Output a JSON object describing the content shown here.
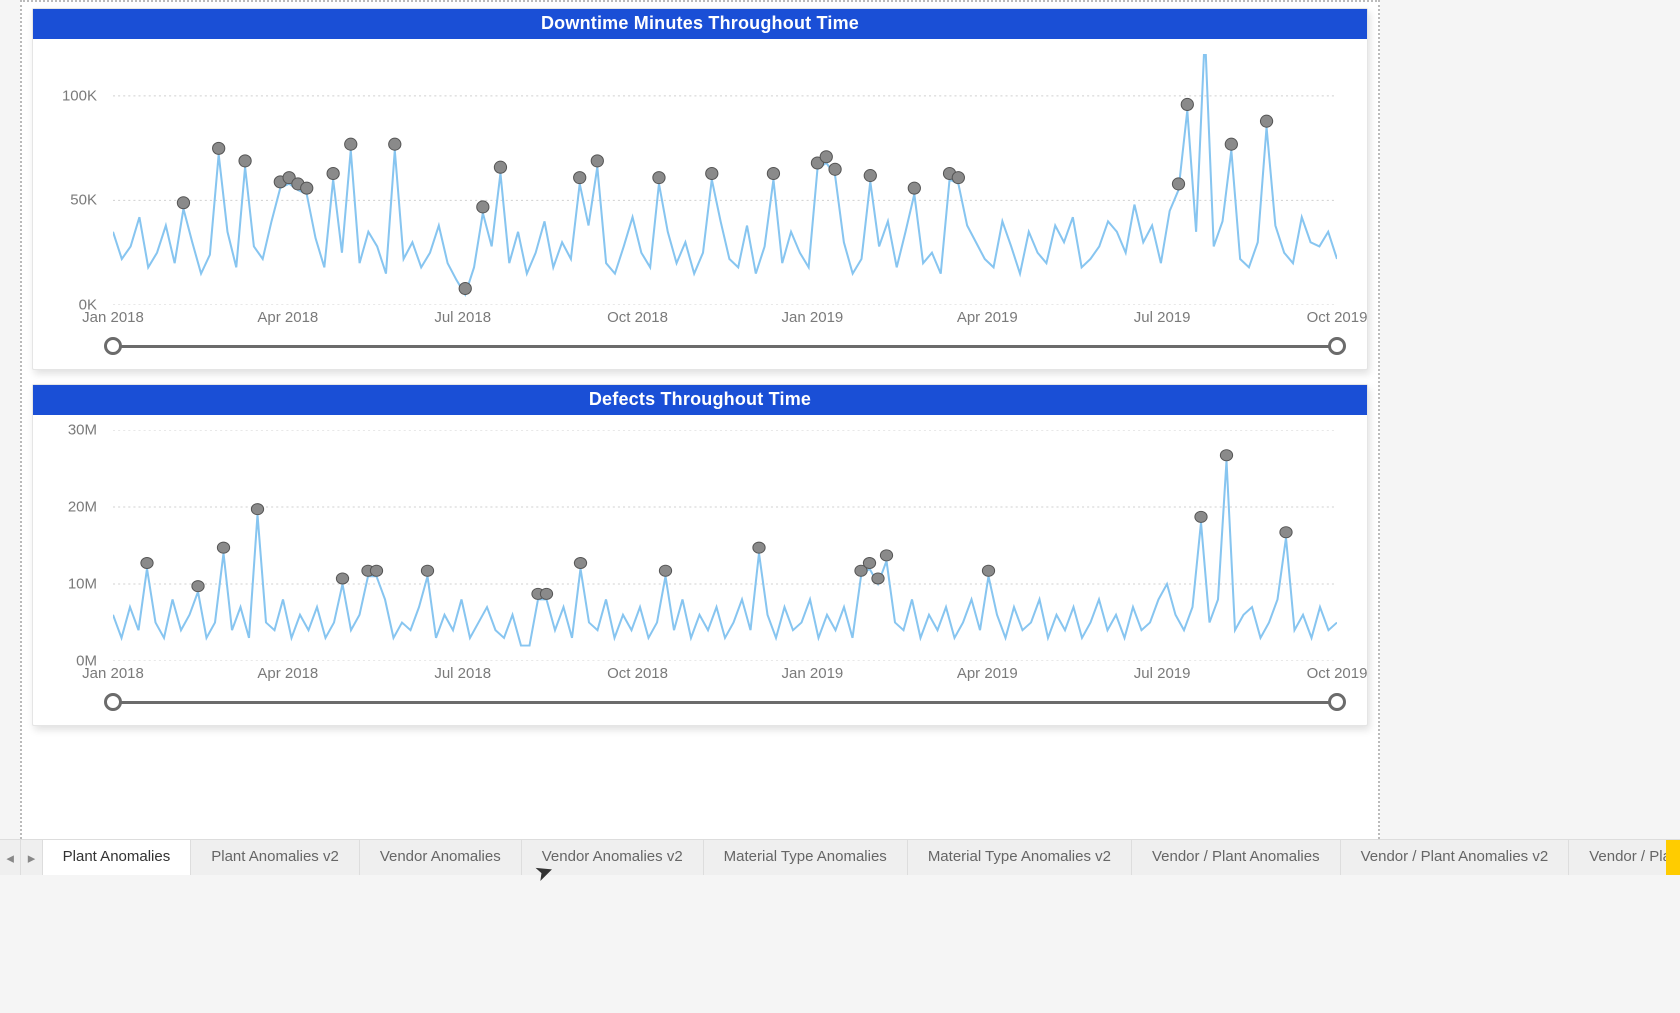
{
  "chart_data": [
    {
      "type": "line",
      "title": "Downtime Minutes Throughout Time",
      "xlabel": "",
      "ylabel": "",
      "ylim": [
        0,
        120000
      ],
      "y_ticks": [
        {
          "v": 0,
          "label": "0K"
        },
        {
          "v": 50000,
          "label": "50K"
        },
        {
          "v": 100000,
          "label": "100K"
        }
      ],
      "x_ticks": [
        "Jan 2018",
        "Apr 2018",
        "Jul 2018",
        "Oct 2018",
        "Jan 2019",
        "Apr 2019",
        "Jul 2019",
        "Oct 2019"
      ],
      "x_range": [
        "2018-01-01",
        "2019-12-31"
      ],
      "series": [
        {
          "name": "Downtime Minutes",
          "values": [
            35000,
            22000,
            28000,
            42000,
            18000,
            25000,
            38000,
            20000,
            46000,
            30000,
            15000,
            24000,
            72000,
            35000,
            18000,
            66000,
            28000,
            22000,
            40000,
            56000,
            58000,
            55000,
            53000,
            32000,
            18000,
            60000,
            25000,
            74000,
            20000,
            35000,
            28000,
            15000,
            74000,
            22000,
            30000,
            18000,
            25000,
            38000,
            20000,
            12000,
            5000,
            18000,
            44000,
            28000,
            63000,
            20000,
            35000,
            15000,
            25000,
            40000,
            18000,
            30000,
            22000,
            58000,
            38000,
            66000,
            20000,
            15000,
            28000,
            42000,
            25000,
            18000,
            58000,
            35000,
            20000,
            30000,
            15000,
            25000,
            60000,
            40000,
            22000,
            18000,
            38000,
            15000,
            28000,
            60000,
            20000,
            35000,
            25000,
            18000,
            65000,
            68000,
            62000,
            30000,
            15000,
            22000,
            59000,
            28000,
            40000,
            18000,
            35000,
            53000,
            20000,
            25000,
            15000,
            60000,
            58000,
            38000,
            30000,
            22000,
            18000,
            40000,
            28000,
            15000,
            35000,
            25000,
            20000,
            38000,
            30000,
            42000,
            18000,
            22000,
            28000,
            40000,
            35000,
            25000,
            48000,
            30000,
            38000,
            20000,
            45000,
            55000,
            93000,
            35000,
            130000,
            28000,
            40000,
            74000,
            22000,
            18000,
            30000,
            85000,
            38000,
            25000,
            20000,
            42000,
            30000,
            28000,
            35000,
            22000
          ],
          "color": "#87c5f0"
        }
      ],
      "anomalies_index": [
        8,
        12,
        15,
        19,
        20,
        21,
        22,
        25,
        27,
        32,
        40,
        42,
        44,
        53,
        55,
        62,
        68,
        75,
        80,
        81,
        82,
        86,
        91,
        95,
        96,
        121,
        122,
        124,
        127,
        131
      ],
      "anomalies_xy": [
        {
          "x": "2018-02-05",
          "y": 46000
        },
        {
          "x": "2018-02-20",
          "y": 72000
        },
        {
          "x": "2018-02-27",
          "y": 66000
        },
        {
          "x": "2018-03-25",
          "y": 56000
        },
        {
          "x": "2018-03-28",
          "y": 58000
        },
        {
          "x": "2018-04-01",
          "y": 55000
        },
        {
          "x": "2018-04-04",
          "y": 53000
        },
        {
          "x": "2018-04-15",
          "y": 60000
        },
        {
          "x": "2018-04-25",
          "y": 74000
        },
        {
          "x": "2018-05-15",
          "y": 74000
        },
        {
          "x": "2018-07-25",
          "y": 5000
        },
        {
          "x": "2018-08-01",
          "y": 44000
        },
        {
          "x": "2018-08-10",
          "y": 63000
        },
        {
          "x": "2018-09-20",
          "y": 58000
        },
        {
          "x": "2018-09-28",
          "y": 66000
        },
        {
          "x": "2018-11-20",
          "y": 58000
        },
        {
          "x": "2018-12-25",
          "y": 60000
        },
        {
          "x": "2019-01-30",
          "y": 60000
        },
        {
          "x": "2019-03-01",
          "y": 65000
        },
        {
          "x": "2019-03-05",
          "y": 68000
        },
        {
          "x": "2019-03-08",
          "y": 62000
        },
        {
          "x": "2019-03-25",
          "y": 59000
        },
        {
          "x": "2019-04-15",
          "y": 53000
        },
        {
          "x": "2019-05-05",
          "y": 60000
        },
        {
          "x": "2019-05-08",
          "y": 58000
        },
        {
          "x": "2019-09-12",
          "y": 55000
        },
        {
          "x": "2019-09-15",
          "y": 93000
        },
        {
          "x": "2019-10-10",
          "y": 74000
        },
        {
          "x": "2019-11-05",
          "y": 85000
        }
      ]
    },
    {
      "type": "line",
      "title": "Defects Throughout Time",
      "xlabel": "",
      "ylabel": "",
      "ylim": [
        0,
        30000000
      ],
      "y_ticks": [
        {
          "v": 0,
          "label": "0M"
        },
        {
          "v": 10000000,
          "label": "10M"
        },
        {
          "v": 20000000,
          "label": "20M"
        },
        {
          "v": 30000000,
          "label": "30M"
        }
      ],
      "x_ticks": [
        "Jan 2018",
        "Apr 2018",
        "Jul 2018",
        "Oct 2018",
        "Jan 2019",
        "Apr 2019",
        "Jul 2019",
        "Oct 2019"
      ],
      "x_range": [
        "2018-01-01",
        "2019-12-31"
      ],
      "series": [
        {
          "name": "Defects",
          "values": [
            6,
            3,
            7,
            4,
            12,
            5,
            3,
            8,
            4,
            6,
            9,
            3,
            5,
            14,
            4,
            7,
            3,
            19,
            5,
            4,
            8,
            3,
            6,
            4,
            7,
            3,
            5,
            10,
            4,
            6,
            11,
            11,
            8,
            3,
            5,
            4,
            7,
            11,
            3,
            6,
            4,
            8,
            3,
            5,
            7,
            4,
            3,
            6,
            2,
            2,
            8,
            8,
            4,
            7,
            3,
            12,
            5,
            4,
            8,
            3,
            6,
            4,
            7,
            3,
            5,
            11,
            4,
            8,
            3,
            6,
            4,
            7,
            3,
            5,
            8,
            4,
            14,
            6,
            3,
            7,
            4,
            5,
            8,
            3,
            6,
            4,
            7,
            3,
            11,
            12,
            10,
            13,
            5,
            4,
            8,
            3,
            6,
            4,
            7,
            3,
            5,
            8,
            4,
            11,
            6,
            3,
            7,
            4,
            5,
            8,
            3,
            6,
            4,
            7,
            3,
            5,
            8,
            4,
            6,
            3,
            7,
            4,
            5,
            8,
            10,
            6,
            4,
            7,
            18,
            5,
            8,
            26,
            4,
            6,
            7,
            3,
            5,
            8,
            16,
            4,
            6,
            3,
            7,
            4,
            5
          ],
          "scale": 1000000,
          "color": "#87c5f0"
        }
      ],
      "anomalies_index": [
        4,
        10,
        13,
        17,
        27,
        30,
        31,
        37,
        50,
        51,
        55,
        65,
        76,
        88,
        89,
        90,
        91,
        103,
        128,
        131,
        138
      ],
      "anomalies_xy": [
        {
          "x": "2018-01-20",
          "y": 12000000
        },
        {
          "x": "2018-02-10",
          "y": 9000000
        },
        {
          "x": "2018-02-22",
          "y": 14000000
        },
        {
          "x": "2018-03-05",
          "y": 19000000
        },
        {
          "x": "2018-04-10",
          "y": 10000000
        },
        {
          "x": "2018-04-20",
          "y": 11000000
        },
        {
          "x": "2018-04-22",
          "y": 11000000
        },
        {
          "x": "2018-05-10",
          "y": 11000000
        },
        {
          "x": "2018-07-28",
          "y": 8000000
        },
        {
          "x": "2018-07-30",
          "y": 8000000
        },
        {
          "x": "2018-08-15",
          "y": 12000000
        },
        {
          "x": "2018-09-25",
          "y": 11000000
        },
        {
          "x": "2018-11-25",
          "y": 14000000
        },
        {
          "x": "2019-02-28",
          "y": 11000000
        },
        {
          "x": "2019-03-03",
          "y": 12000000
        },
        {
          "x": "2019-03-06",
          "y": 10000000
        },
        {
          "x": "2019-03-10",
          "y": 13000000
        },
        {
          "x": "2019-05-05",
          "y": 11000000
        },
        {
          "x": "2019-09-15",
          "y": 18000000
        },
        {
          "x": "2019-11-05",
          "y": 16000000
        }
      ]
    }
  ],
  "tabs": {
    "items": [
      "Plant Anomalies",
      "Plant Anomalies v2",
      "Vendor Anomalies",
      "Vendor Anomalies v2",
      "Material Type Anomalies",
      "Material Type Anomalies v2",
      "Vendor / Plant Anomalies",
      "Vendor / Plant Anomalies v2",
      "Vendor / Plant Ano"
    ],
    "active_index": 0,
    "nav_prev": "◂",
    "nav_next": "▸"
  }
}
